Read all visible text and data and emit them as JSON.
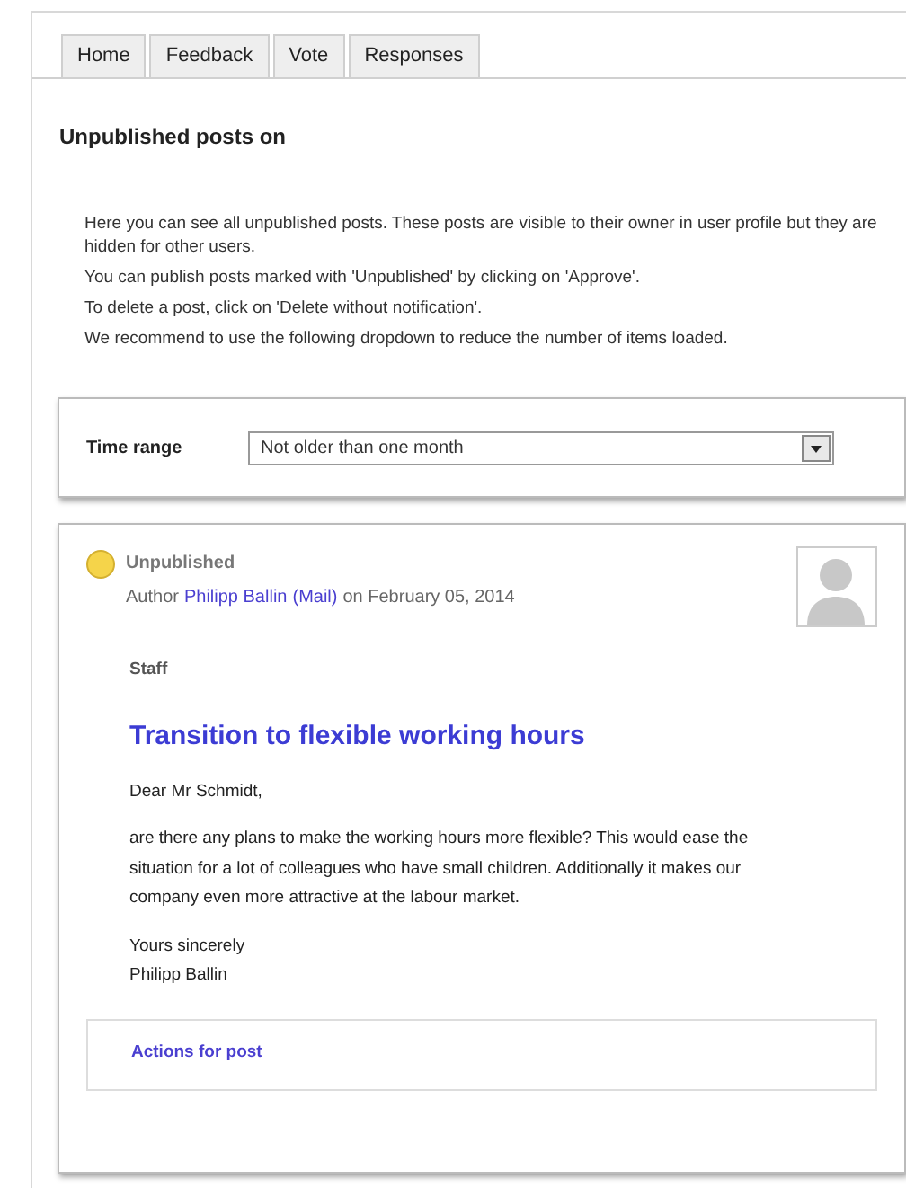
{
  "tabs": [
    {
      "label": "Home",
      "selected": false
    },
    {
      "label": "Feedback",
      "selected": false
    },
    {
      "label": "Vote",
      "selected": false
    },
    {
      "label": "Responses",
      "selected": false
    }
  ],
  "heading": "Unpublished posts on",
  "intro": [
    "Here you can see all unpublished posts. These posts are visible to their owner in user profile but they are hidden for other users.",
    "You can publish posts marked with 'Unpublished' by clicking on 'Approve'.",
    "To delete a post, click on 'Delete without notification'.",
    "We recommend to use the following dropdown to reduce the number of items loaded."
  ],
  "filter": {
    "label": "Time range",
    "value": "Not older than one month"
  },
  "post": {
    "status": "Unpublished",
    "color": "#f5d44a",
    "author_prefix": "Author",
    "author": "Philipp Ballin",
    "mail_link": "(Mail)",
    "date": "on February 05, 2014",
    "category": "Staff",
    "title": "Transition to flexible working hours",
    "greeting": "Dear Mr Schmidt,",
    "body": "are there any plans to make the working hours more flexible? This would ease the situation for a lot of colleagues who have small children. Additionally it makes our company even more attractive at the labour market.",
    "closing": "Yours sincerely",
    "signature": "Philipp Ballin",
    "actions": "Actions for post"
  }
}
